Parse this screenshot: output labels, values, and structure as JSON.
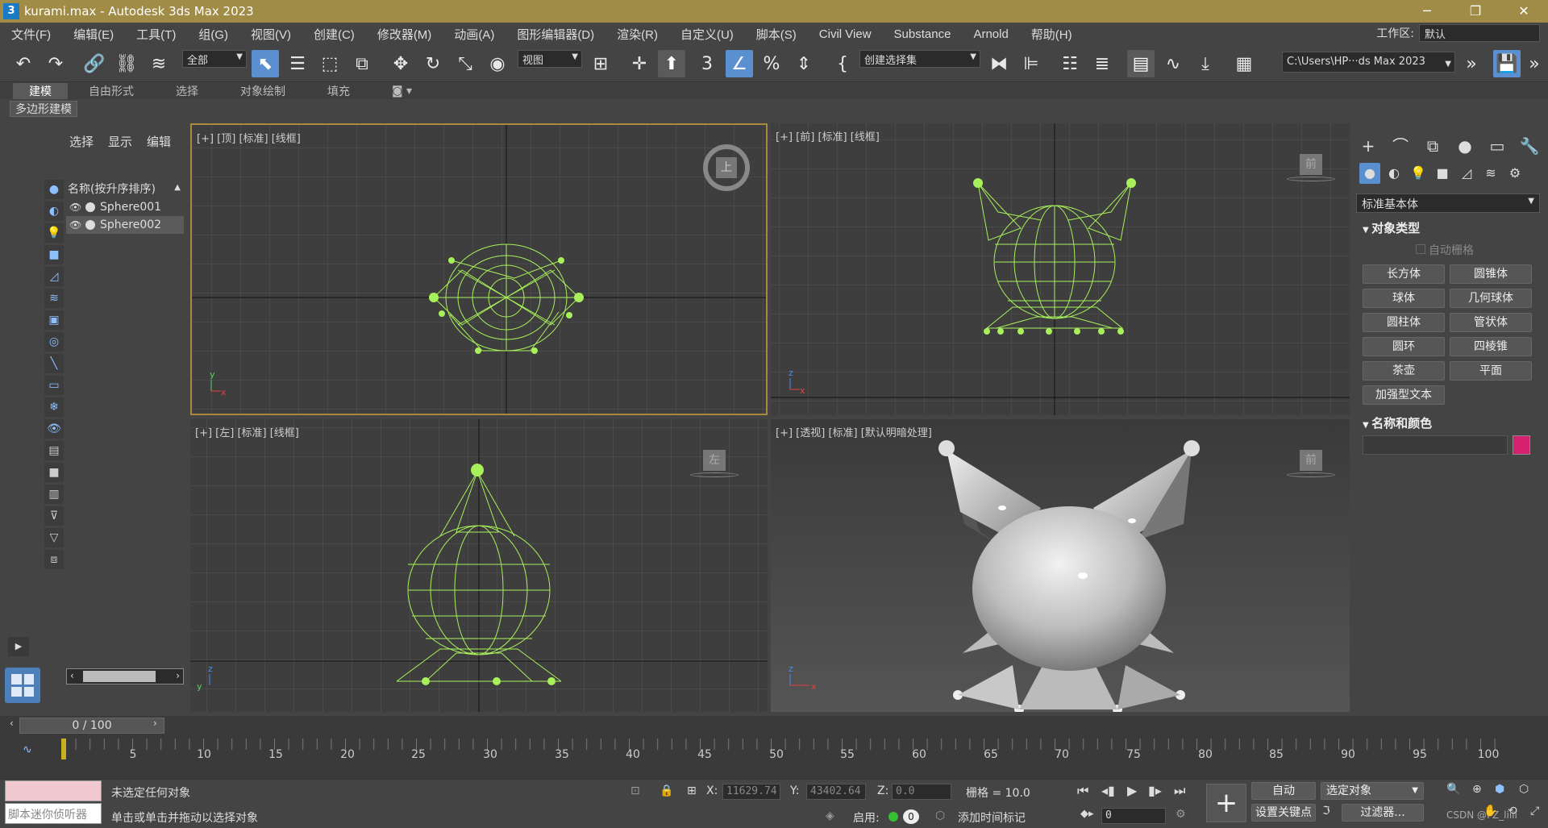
{
  "window": {
    "title": "kurami.max - Autodesk 3ds Max 2023",
    "app_icon": "3",
    "minimize": "─",
    "maximize": "❐",
    "close": "✕"
  },
  "menu": [
    "文件(F)",
    "编辑(E)",
    "工具(T)",
    "组(G)",
    "视图(V)",
    "创建(C)",
    "修改器(M)",
    "动画(A)",
    "图形编辑器(D)",
    "渲染(R)",
    "自定义(U)",
    "脚本(S)",
    "Civil View",
    "Substance",
    "Arnold",
    "帮助(H)"
  ],
  "workspace": {
    "label": "工作区:",
    "value": "默认"
  },
  "toolbar": {
    "filter_select": "全部",
    "ref_coord_select": "视图",
    "selection_set": "创建选择集",
    "path": "C:\\Users\\HP···ds Max 2023"
  },
  "ribbon": {
    "tabs": [
      "建模",
      "自由形式",
      "选择",
      "对象绘制",
      "填充"
    ],
    "active_tab": "建模",
    "panel_label": "多边形建模"
  },
  "scene_explorer": {
    "tabs": [
      "选择",
      "显示",
      "编辑"
    ],
    "column_header": "名称(按升序排序)",
    "sort_arrow": "▲",
    "items": [
      "Sphere001",
      "Sphere002"
    ]
  },
  "viewports": {
    "top": {
      "label": "[+] [顶] [标准] [线框]",
      "cube": "上"
    },
    "front": {
      "label": "[+] [前] [标准] [线框]",
      "cube": "前"
    },
    "left": {
      "label": "[+] [左] [标准] [线框]",
      "cube": "左"
    },
    "persp": {
      "label": "[+] [透视] [标准] [默认明暗处理]",
      "cube": "前"
    }
  },
  "command_panel": {
    "category": "标准基本体",
    "object_type_header": "对象类型",
    "autogrid": "自动栅格",
    "buttons": [
      "长方体",
      "圆锥体",
      "球体",
      "几何球体",
      "圆柱体",
      "管状体",
      "圆环",
      "四棱锥",
      "茶壶",
      "平面",
      "加强型文本"
    ],
    "name_color_header": "名称和颜色",
    "object_color": "#d4216f"
  },
  "timeline": {
    "frame_display": "0 / 100",
    "ticks": [
      "5",
      "10",
      "15",
      "20",
      "25",
      "30",
      "35",
      "40",
      "45",
      "50",
      "55",
      "60",
      "65",
      "70",
      "75",
      "80",
      "85",
      "90",
      "95",
      "100"
    ]
  },
  "status": {
    "maxscript": "脚本迷你侦听器",
    "line1": "未选定任何对象",
    "line2": "单击或单击并拖动以选择对象",
    "x_label": "X:",
    "x": "11629.74",
    "y_label": "Y:",
    "y": "43402.64",
    "z_label": "Z:",
    "z": "0.0",
    "grid": "栅格 = 10.0",
    "enable": "启用:",
    "add_time_tag": "添加时间标记",
    "auto_key": "自动",
    "set_key": "设置关键点",
    "key_mode": "选定对象",
    "filters": "过滤器...",
    "current_frame": "0",
    "watermark": "CSDN @FZ_lilil"
  }
}
